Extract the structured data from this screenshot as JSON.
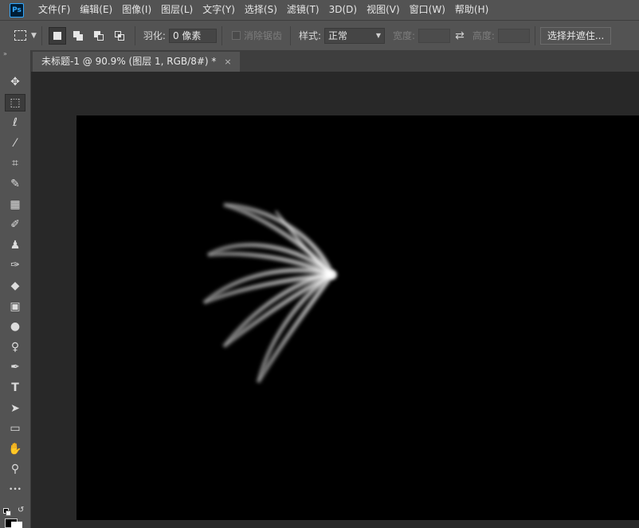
{
  "app": {
    "logo_text": "Ps"
  },
  "menu": {
    "items": [
      {
        "label": "文件(F)"
      },
      {
        "label": "编辑(E)"
      },
      {
        "label": "图像(I)"
      },
      {
        "label": "图层(L)"
      },
      {
        "label": "文字(Y)"
      },
      {
        "label": "选择(S)"
      },
      {
        "label": "滤镜(T)"
      },
      {
        "label": "3D(D)"
      },
      {
        "label": "视图(V)"
      },
      {
        "label": "窗口(W)"
      },
      {
        "label": "帮助(H)"
      }
    ]
  },
  "options": {
    "feather_label": "羽化:",
    "feather_value": "0 像素",
    "antialias_label": "消除锯齿",
    "style_label": "样式:",
    "style_value": "正常",
    "width_label": "宽度:",
    "height_label": "高度:",
    "select_mask_label": "选择并遮住..."
  },
  "document": {
    "tab_title": "未标题-1 @ 90.9% (图层 1, RGB/8#) *",
    "close_glyph": "×"
  },
  "toolbar": {
    "collapse_glyph": "»",
    "tools": [
      {
        "name": "move-tool",
        "icon": "move-icon",
        "glyph": "✥"
      },
      {
        "name": "rect-marquee-tool",
        "icon": "rect-marquee-icon",
        "glyph": "⬚"
      },
      {
        "name": "lasso-tool",
        "icon": "lasso-icon",
        "glyph": "ℓ"
      },
      {
        "name": "magic-wand-tool",
        "icon": "magic-wand-icon",
        "glyph": "⁄"
      },
      {
        "name": "crop-tool",
        "icon": "crop-icon",
        "glyph": "⌗"
      },
      {
        "name": "eyedropper-tool",
        "icon": "eyedropper-icon",
        "glyph": "✎"
      },
      {
        "name": "healing-brush-tool",
        "icon": "bandage-icon",
        "glyph": "▦"
      },
      {
        "name": "brush-tool",
        "icon": "brush-icon",
        "glyph": "✐"
      },
      {
        "name": "clone-stamp-tool",
        "icon": "stamp-icon",
        "glyph": "♟"
      },
      {
        "name": "history-brush-tool",
        "icon": "history-brush-icon",
        "glyph": "✑"
      },
      {
        "name": "eraser-tool",
        "icon": "eraser-icon",
        "glyph": "◆"
      },
      {
        "name": "gradient-tool",
        "icon": "gradient-icon",
        "glyph": "▣"
      },
      {
        "name": "blur-tool",
        "icon": "drop-icon",
        "glyph": "●"
      },
      {
        "name": "dodge-tool",
        "icon": "dodge-icon",
        "glyph": "♀"
      },
      {
        "name": "pen-tool",
        "icon": "pen-icon",
        "glyph": "✒"
      },
      {
        "name": "type-tool",
        "icon": "type-icon",
        "glyph": "T"
      },
      {
        "name": "path-selection-tool",
        "icon": "arrow-icon",
        "glyph": "➤"
      },
      {
        "name": "rectangle-tool",
        "icon": "rectangle-icon",
        "glyph": "▭"
      },
      {
        "name": "hand-tool",
        "icon": "hand-icon",
        "glyph": "✋"
      },
      {
        "name": "zoom-tool",
        "icon": "zoom-icon",
        "glyph": "⚲"
      },
      {
        "name": "more-tools",
        "icon": "ellipsis-icon",
        "glyph": "•••"
      }
    ]
  },
  "colors": {
    "foreground": "#000000",
    "background": "#ffffff",
    "panel": "#535353",
    "workspace": "#282828",
    "canvas": "#000000"
  }
}
